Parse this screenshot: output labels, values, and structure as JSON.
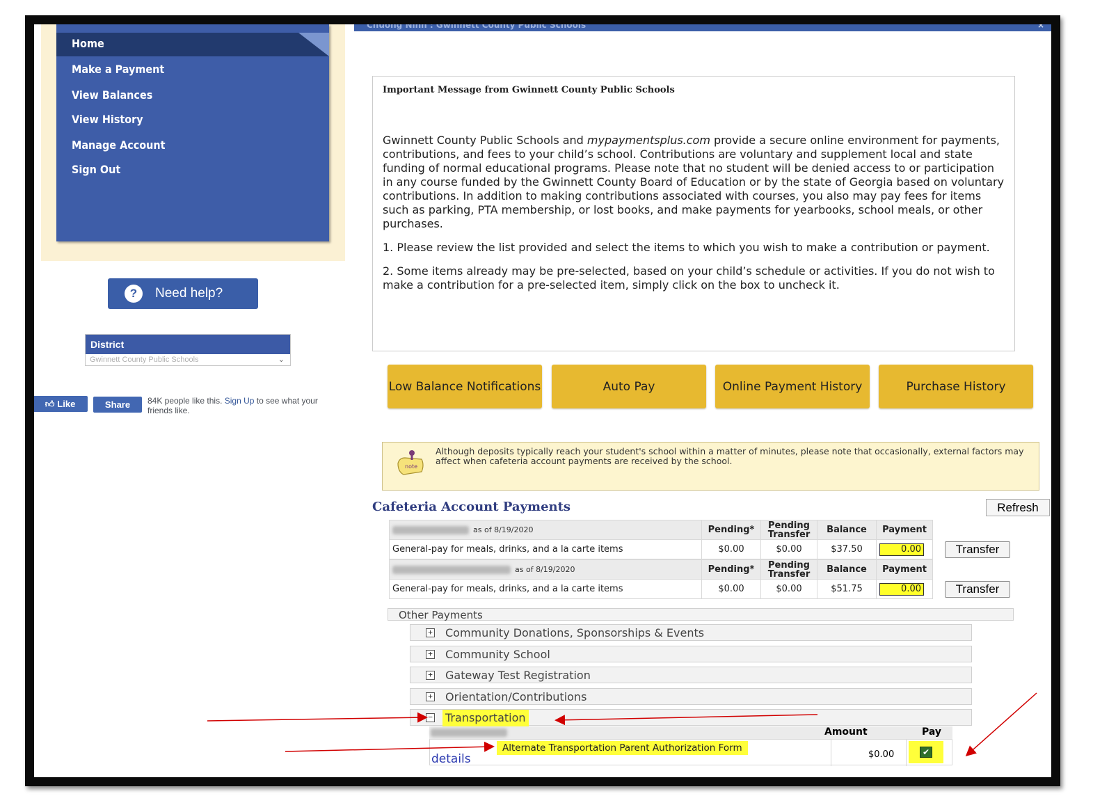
{
  "header": {
    "title_partial": "Chuong Ninh : Gwinnett County Public Schools",
    "close_glyph": "×"
  },
  "sidebar": {
    "items": [
      {
        "label": "Home"
      },
      {
        "label": "Make a Payment"
      },
      {
        "label": "View Balances"
      },
      {
        "label": "View History"
      },
      {
        "label": "Manage Account"
      },
      {
        "label": "Sign Out"
      }
    ],
    "help_button": "Need help?",
    "district_label": "District",
    "district_value": "Gwinnett County Public Schools"
  },
  "facebook": {
    "like": "Like",
    "share": "Share",
    "text_before": "84K people like this. ",
    "signup": "Sign Up",
    "text_after": " to see what your friends like."
  },
  "message": {
    "title": "Important Message from Gwinnett County Public Schools",
    "p1_a": "Gwinnett County Public Schools and ",
    "p1_em": "mypaymentsplus.com",
    "p1_b": " provide a secure online environment for payments, contributions, and fees to your child’s school. Contributions are voluntary and supplement local and state funding of normal educational programs. Please note that no student will be denied access to or participation in any course funded by the Gwinnett County Board of Education or by the state of Georgia based on voluntary contributions. In addition to making contributions associated with courses, you also may pay fees for items such as parking, PTA membership, or lost books, and make payments for yearbooks, school meals, or other purchases.",
    "p2": "1. Please review the list provided and select the items to which you wish to make a contribution or payment.",
    "p3": "2. Some items already may be pre-selected, based on your child’s schedule or activities. If you do not wish to make a contribution for a pre-selected item, simply click on the box to uncheck it."
  },
  "action_buttons": [
    "Low Balance Notifications",
    "Auto Pay",
    "Online Payment History",
    "Purchase History"
  ],
  "note": "Although deposits typically reach your student's school within a matter of minutes, please note that occasionally, external factors may affect when cafeteria account payments are received by the school.",
  "cafeteria": {
    "title": "Cafeteria Account Payments",
    "refresh": "Refresh",
    "headers": {
      "pending": "Pending*",
      "pending_transfer": "Pending Transfer",
      "balance": "Balance",
      "payment": "Payment"
    },
    "accounts": [
      {
        "as_of": "as of 8/19/2020",
        "desc": "General-pay for meals, drinks, and a la carte items",
        "pending": "$0.00",
        "pending_transfer": "$0.00",
        "balance": "$37.50",
        "payment": "0.00",
        "transfer": "Transfer"
      },
      {
        "as_of": "as of 8/19/2020",
        "desc": "General-pay for meals, drinks, and a la carte items",
        "pending": "$0.00",
        "pending_transfer": "$0.00",
        "balance": "$51.75",
        "payment": "0.00",
        "transfer": "Transfer"
      }
    ]
  },
  "other_payments": {
    "label": "Other Payments",
    "categories": [
      {
        "label": "Community Donations, Sponsorships & Events",
        "toggle": "+"
      },
      {
        "label": "Community School",
        "toggle": "+"
      },
      {
        "label": "Gateway Test Registration",
        "toggle": "+"
      },
      {
        "label": "Orientation/Contributions",
        "toggle": "+"
      },
      {
        "label": "Transportation",
        "toggle": "−"
      }
    ],
    "transportation": {
      "amount_header": "Amount",
      "pay_header": "Pay",
      "form_name": "Alternate Transportation Parent Authorization Form",
      "details": "details",
      "amount": "$0.00",
      "checked": true
    }
  },
  "colors": {
    "nav_blue": "#3e5da8",
    "nav_dark": "#223a6e",
    "button_gold": "#e7b930",
    "highlight": "#ffff3a",
    "annotation_red": "#d10000"
  }
}
